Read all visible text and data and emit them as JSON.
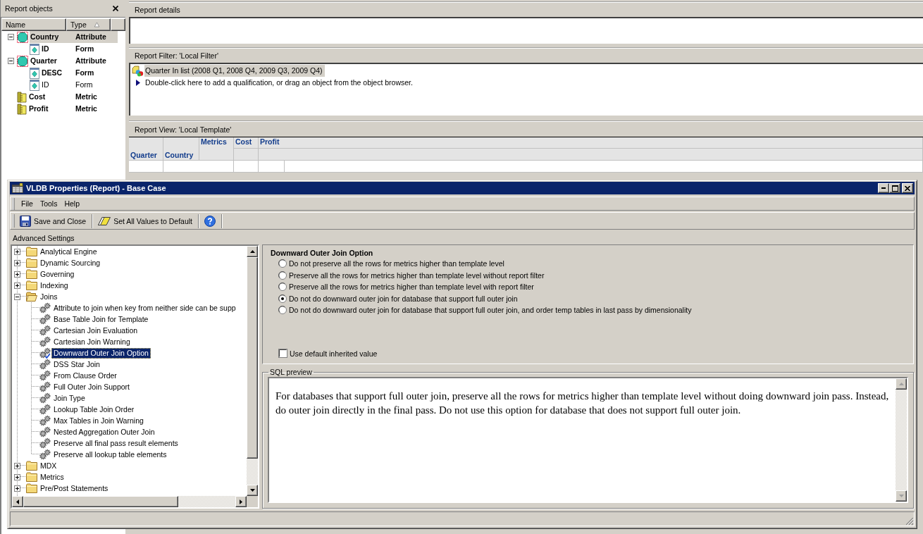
{
  "report_objects": {
    "title": "Report objects",
    "columns": [
      {
        "label": "Name",
        "sorted": false
      },
      {
        "label": "Type",
        "sorted": true
      }
    ],
    "items": [
      {
        "name": "Country",
        "type": "Attribute",
        "kind": "attribute",
        "bold": true,
        "selected": true,
        "expanded": true,
        "children": [
          {
            "name": "ID",
            "type": "Form",
            "kind": "form",
            "bold": true,
            "selected": false
          }
        ]
      },
      {
        "name": "Quarter",
        "type": "Attribute",
        "kind": "attribute",
        "bold": true,
        "selected": false,
        "expanded": true,
        "children": [
          {
            "name": "DESC",
            "type": "Form",
            "kind": "form",
            "bold": true,
            "selected": false
          },
          {
            "name": "ID",
            "type": "Form",
            "kind": "form",
            "bold": false,
            "selected": false
          }
        ]
      },
      {
        "name": "Cost",
        "type": "Metric",
        "kind": "metric",
        "bold": true,
        "selected": false
      },
      {
        "name": "Profit",
        "type": "Metric",
        "kind": "metric",
        "bold": true,
        "selected": false
      }
    ]
  },
  "report_details": {
    "title": "Report details"
  },
  "report_filter": {
    "title": "Report Filter: 'Local Filter'",
    "items": [
      {
        "kind": "qualification",
        "text": "Quarter In list (2008 Q1, 2008 Q4, 2009 Q3, 2009 Q4)",
        "selected": true
      },
      {
        "kind": "hint",
        "text": "Double-click here to add a qualification, or drag an object from the object browser.",
        "selected": false
      }
    ]
  },
  "report_view": {
    "title": "Report View: 'Local Template'",
    "row_headers": [
      "Quarter",
      "Country"
    ],
    "column_header": "Metrics",
    "metrics": [
      "Cost",
      "Profit"
    ]
  },
  "dialog": {
    "title": "VLDB Properties (Report) - Base Case",
    "menu": [
      "File",
      "Tools",
      "Help"
    ],
    "toolbar": [
      {
        "kind": "save",
        "label": "Save and Close"
      },
      {
        "kind": "reset",
        "label": "Set All Values to Default"
      },
      {
        "kind": "help"
      }
    ],
    "section_label": "Advanced Settings",
    "tree": [
      {
        "label": "Analytical Engine",
        "expanded": false,
        "selected": false
      },
      {
        "label": "Dynamic Sourcing",
        "expanded": false,
        "selected": false
      },
      {
        "label": "Governing",
        "expanded": false,
        "selected": false
      },
      {
        "label": "Indexing",
        "expanded": false,
        "selected": false
      },
      {
        "label": "Joins",
        "expanded": true,
        "selected": false,
        "children": [
          {
            "label": "Attribute to join when key from neither side can be supp",
            "selected": false,
            "modified": false
          },
          {
            "label": "Base Table Join for Template",
            "selected": false,
            "modified": false
          },
          {
            "label": "Cartesian Join Evaluation",
            "selected": false,
            "modified": false
          },
          {
            "label": "Cartesian Join Warning",
            "selected": false,
            "modified": false
          },
          {
            "label": "Downward Outer Join Option",
            "selected": true,
            "modified": true
          },
          {
            "label": "DSS Star Join",
            "selected": false,
            "modified": false
          },
          {
            "label": "From Clause Order",
            "selected": false,
            "modified": false
          },
          {
            "label": "Full Outer Join Support",
            "selected": false,
            "modified": false
          },
          {
            "label": "Join Type",
            "selected": false,
            "modified": false
          },
          {
            "label": "Lookup Table Join Order",
            "selected": false,
            "modified": false
          },
          {
            "label": "Max Tables in Join Warning",
            "selected": false,
            "modified": false
          },
          {
            "label": "Nested Aggregation Outer Join",
            "selected": false,
            "modified": false
          },
          {
            "label": "Preserve all final pass result elements",
            "selected": false,
            "modified": false
          },
          {
            "label": "Preserve all lookup table elements",
            "selected": false,
            "modified": false
          }
        ]
      },
      {
        "label": "MDX",
        "expanded": false,
        "selected": false
      },
      {
        "label": "Metrics",
        "expanded": false,
        "selected": false
      },
      {
        "label": "Pre/Post Statements",
        "expanded": false,
        "selected": false
      }
    ],
    "setting": {
      "title": "Downward Outer Join Option",
      "options": [
        {
          "label": "Do not preserve all the rows for metrics higher than template level",
          "selected": false
        },
        {
          "label": "Preserve all the rows for metrics higher than template level without report filter",
          "selected": false
        },
        {
          "label": "Preserve all the rows for metrics higher than template level with report filter",
          "selected": false
        },
        {
          "label": "Do not do downward outer join for database that support full outer join",
          "selected": true
        },
        {
          "label": "Do not do downward outer join for database that support full outer join, and order temp tables in last pass by dimensionality",
          "selected": false
        }
      ],
      "use_default": {
        "label": "Use default inherited value",
        "checked": false
      }
    },
    "sql_preview": {
      "title": "SQL preview",
      "text": "For databases that support full outer join, preserve all the rows for metrics higher than template level without doing downward join pass. Instead, do outer join directly in the final pass. Do not use this option for database that does not support full outer join."
    }
  }
}
